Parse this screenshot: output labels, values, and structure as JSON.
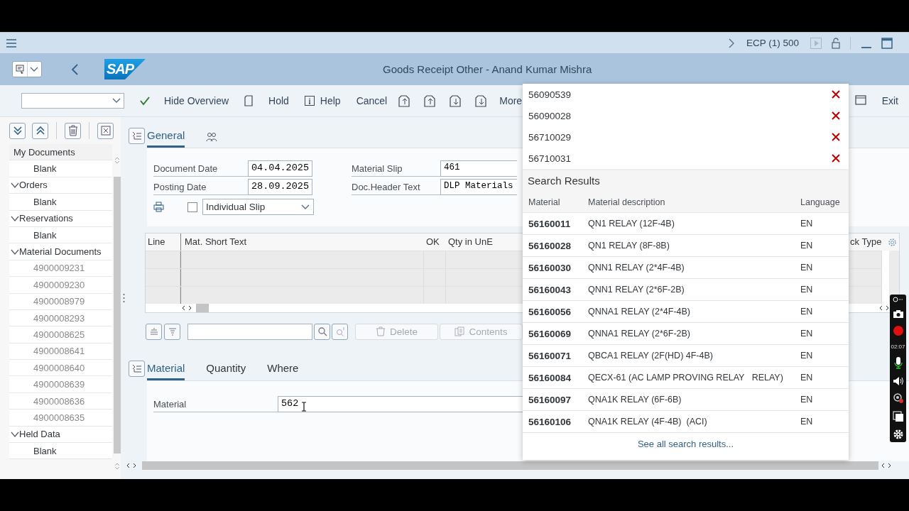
{
  "shell": {
    "system": "ECP (1) 500"
  },
  "title_bar": {
    "logo": "SAP",
    "title": "Goods Receipt Other - Anand Kumar Mishra"
  },
  "toolbar": {
    "buttons": [
      "Hide Overview",
      "Hold",
      "Help",
      "Cancel",
      "More",
      "Exit"
    ]
  },
  "tree": {
    "nodes": [
      {
        "label": "My Documents",
        "kind": "root",
        "children": [
          {
            "label": "Blank",
            "disabled": false
          }
        ]
      },
      {
        "label": "Orders",
        "kind": "folder",
        "expanded": true,
        "children": [
          {
            "label": "Blank",
            "disabled": false
          }
        ]
      },
      {
        "label": "Reservations",
        "kind": "folder",
        "expanded": true,
        "children": [
          {
            "label": "Blank",
            "disabled": false
          }
        ]
      },
      {
        "label": "Material Documents",
        "kind": "folder",
        "expanded": true,
        "children": [
          {
            "label": "4900009231",
            "disabled": true
          },
          {
            "label": "4900009230",
            "disabled": true
          },
          {
            "label": "4900008979",
            "disabled": true
          },
          {
            "label": "4900008293",
            "disabled": true
          },
          {
            "label": "4900008625",
            "disabled": true
          },
          {
            "label": "4900008641",
            "disabled": true
          },
          {
            "label": "4900008640",
            "disabled": true
          },
          {
            "label": "4900008639",
            "disabled": true
          },
          {
            "label": "4900008636",
            "disabled": true
          },
          {
            "label": "4900008635",
            "disabled": true
          }
        ]
      },
      {
        "label": "Held Data",
        "kind": "folder",
        "expanded": true,
        "children": [
          {
            "label": "Blank",
            "disabled": false
          }
        ]
      }
    ]
  },
  "general": {
    "tabs": [
      {
        "label": "General",
        "selected": true
      }
    ],
    "fields": [
      {
        "label": "Document Date",
        "value": "04.04.2025"
      },
      {
        "label": "Posting Date",
        "value": "28.09.2025"
      }
    ],
    "print_slip": {
      "checked": false,
      "value": "Individual Slip"
    },
    "right_fields": [
      {
        "label": "Material Slip",
        "value": "461"
      },
      {
        "label": "Doc.Header Text",
        "value": "DLP Materials"
      }
    ]
  },
  "items_table": {
    "columns": [
      "Line",
      "Mat. Short Text",
      "OK",
      "Qty in UnE",
      "ck Type"
    ],
    "buttons": [
      {
        "label": "Delete",
        "disabled": true
      },
      {
        "label": "Contents",
        "disabled": true
      }
    ]
  },
  "detail": {
    "tabs": [
      {
        "label": "Material",
        "selected": true
      },
      {
        "label": "Quantity",
        "selected": false
      },
      {
        "label": "Where",
        "selected": false
      }
    ],
    "field": {
      "label": "Material",
      "value": "562"
    }
  },
  "search_popup": {
    "recent": [
      "56090539",
      "56090028",
      "56710029",
      "56710031"
    ],
    "title": "Search Results",
    "columns": [
      "Material",
      "Material description",
      "Language"
    ],
    "rows": [
      {
        "material": "56160011",
        "description": "QN1 RELAY (12F-4B)",
        "language": "EN"
      },
      {
        "material": "56160028",
        "description": "QN1 RELAY (8F-8B)",
        "language": "EN"
      },
      {
        "material": "56160030",
        "description": "QNN1 RELAY (2*4F-4B)",
        "language": "EN"
      },
      {
        "material": "56160043",
        "description": "QNN1 RELAY (2*6F-2B)",
        "language": "EN"
      },
      {
        "material": "56160056",
        "description": "QNNA1 RELAY (2*4F-4B)",
        "language": "EN"
      },
      {
        "material": "56160069",
        "description": "QNNA1 RELAY (2*6F-2B)",
        "language": "EN"
      },
      {
        "material": "56160071",
        "description": "QBCA1 RELAY (2F(HD) 4F-4B)",
        "language": "EN"
      },
      {
        "material": "56160084",
        "description": "QECX-61 (AC LAMP PROVING RELAY   RELAY)",
        "language": "EN"
      },
      {
        "material": "56160097",
        "description": "QNA1K RELAY (6F-6B)",
        "language": "EN"
      },
      {
        "material": "56160106",
        "description": "QNA1K RELAY (4F-4B)  (ACI)",
        "language": "EN"
      }
    ],
    "link": "See all search results..."
  },
  "recorder": {
    "timer": "02:07",
    "recording": true
  }
}
